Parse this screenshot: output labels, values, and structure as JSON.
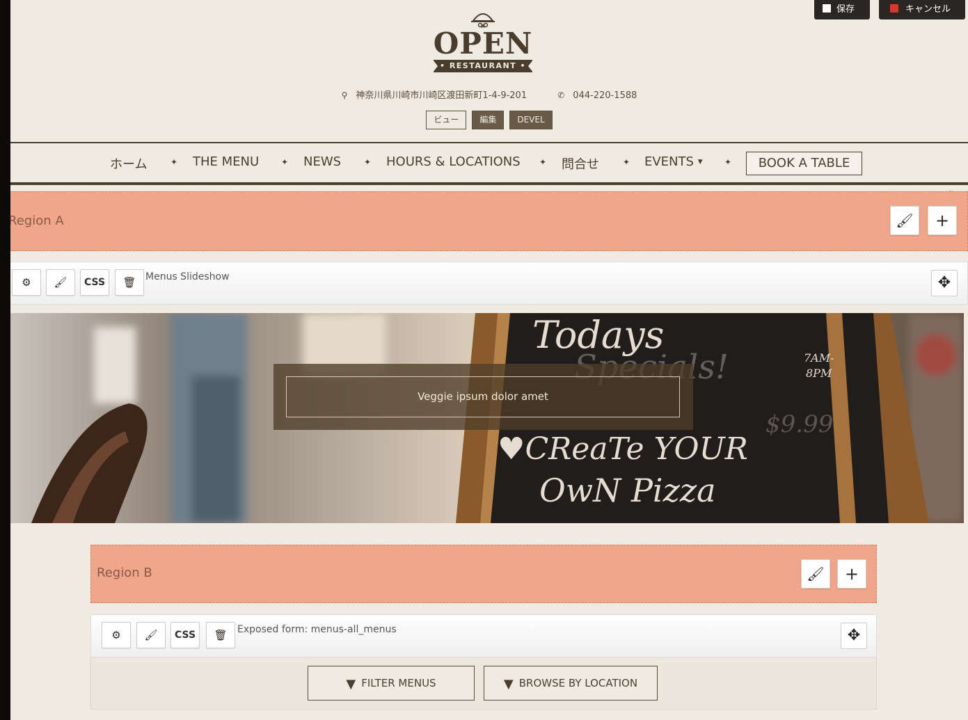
{
  "top_buttons": {
    "save": "保存",
    "cancel": "キャンセル"
  },
  "logo": {
    "word": "OPEN",
    "banner": "• RESTAURANT •"
  },
  "contact": {
    "address": "神奈川県川崎市川崎区渡田新町1-4-9-201",
    "phone": "044-220-1588"
  },
  "view_tabs": [
    "ビュー",
    "編集",
    "DEVEL"
  ],
  "nav": {
    "items": [
      "ホーム",
      "THE MENU",
      "NEWS",
      "HOURS & LOCATIONS",
      "問合せ",
      "EVENTS"
    ],
    "separator": "✦",
    "book": "BOOK A TABLE"
  },
  "region_a": {
    "label": "Region A"
  },
  "block_a": {
    "title": "Menus Slideshow",
    "css_label": "CSS"
  },
  "slideshow": {
    "caption": "Veggie ipsum dolor amet",
    "board_lines": [
      "Todays",
      "Specials!",
      "7AM-",
      "8PM",
      "$9.99",
      "♥CReaTe YOUR",
      "OwN Pizza"
    ]
  },
  "region_b": {
    "label": "Region B"
  },
  "block_b": {
    "title": "Exposed form: menus-all_menus",
    "css_label": "CSS"
  },
  "filters": {
    "menus": "FILTER MENUS",
    "location": "BROWSE BY LOCATION"
  },
  "colors": {
    "region": "#f0a68a",
    "brand": "#4b3e2e",
    "page_bg": "#f0ebe2"
  }
}
